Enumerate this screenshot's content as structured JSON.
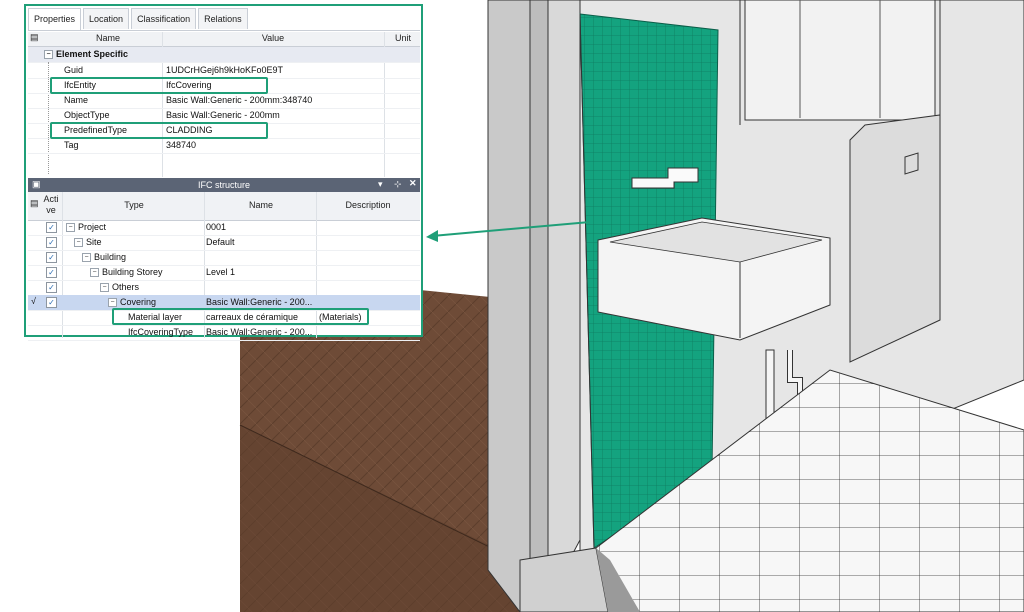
{
  "tabs": [
    "Properties",
    "Location",
    "Classification",
    "Relations"
  ],
  "properties": {
    "headers": {
      "name": "Name",
      "value": "Value",
      "unit": "Unit"
    },
    "category": "Element Specific",
    "rows": [
      {
        "name": "Guid",
        "value": "1UDCrHGej6h9kHoKFo0E9T"
      },
      {
        "name": "IfcEntity",
        "value": "IfcCovering"
      },
      {
        "name": "Name",
        "value": "Basic Wall:Generic - 200mm:348740"
      },
      {
        "name": "ObjectType",
        "value": "Basic Wall:Generic - 200mm"
      },
      {
        "name": "PredefinedType",
        "value": "CLADDING"
      },
      {
        "name": "Tag",
        "value": "348740"
      }
    ]
  },
  "ifc_structure": {
    "title": "IFC structure",
    "headers": {
      "active": "Acti ve",
      "type": "Type",
      "name": "Name",
      "description": "Description"
    },
    "rows": [
      {
        "type": "Project",
        "name": "0001",
        "description": "",
        "checked": true
      },
      {
        "type": "Site",
        "name": "Default",
        "description": "",
        "checked": true
      },
      {
        "type": "Building",
        "name": "",
        "description": "",
        "checked": true
      },
      {
        "type": "Building Storey",
        "name": "Level 1",
        "description": "",
        "checked": true
      },
      {
        "type": "Others",
        "name": "",
        "description": "",
        "checked": true
      },
      {
        "type": "Covering",
        "name": "Basic Wall:Generic - 200...",
        "description": "",
        "checked": true,
        "selected": true
      },
      {
        "type": "Material layer",
        "name": "carreaux de céramique",
        "description": "(Materials)"
      },
      {
        "type": "IfcCoveringType",
        "name": "Basic Wall:Generic - 200...",
        "description": ""
      }
    ]
  },
  "colors": {
    "accent": "#1f9f78",
    "tile": "#14a37f",
    "floor": "#6b4a36",
    "wall": "#e4e4e4"
  }
}
